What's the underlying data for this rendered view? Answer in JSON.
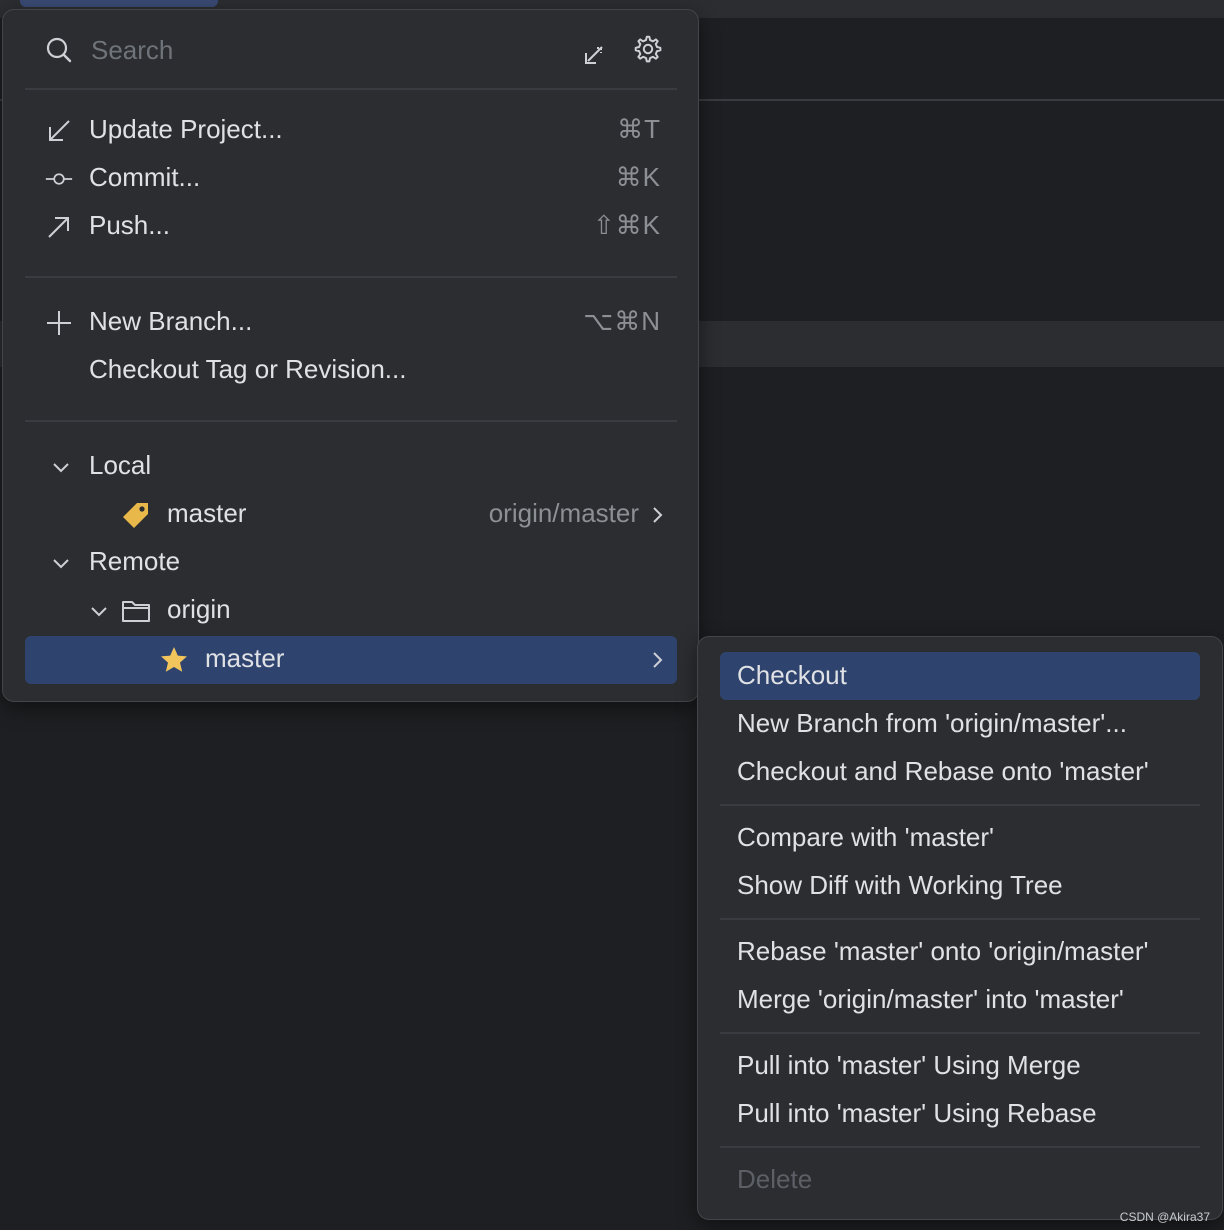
{
  "search": {
    "placeholder": "Search"
  },
  "actions": [
    {
      "label": "Update Project...",
      "shortcut": "⌘T",
      "icon": "update-arrow-icon"
    },
    {
      "label": "Commit...",
      "shortcut": "⌘K",
      "icon": "commit-icon"
    },
    {
      "label": "Push...",
      "shortcut": "⇧⌘K",
      "icon": "push-arrow-icon"
    }
  ],
  "branch_actions": [
    {
      "label": "New Branch...",
      "shortcut": "⌥⌘N",
      "icon": "plus-icon"
    },
    {
      "label": "Checkout Tag or Revision..."
    }
  ],
  "tree": {
    "local": {
      "label": "Local",
      "branches": [
        {
          "name": "master",
          "tracking": "origin/master",
          "icon": "tag-icon"
        }
      ]
    },
    "remote": {
      "label": "Remote",
      "remotes": [
        {
          "name": "origin",
          "icon": "folder-icon",
          "branches": [
            {
              "name": "master",
              "icon": "star-icon",
              "selected": true
            }
          ]
        }
      ]
    }
  },
  "submenu": {
    "groups": [
      [
        "Checkout",
        "New Branch from 'origin/master'...",
        "Checkout and Rebase onto 'master'"
      ],
      [
        "Compare with 'master'",
        "Show Diff with Working Tree"
      ],
      [
        "Rebase 'master' onto 'origin/master'",
        "Merge 'origin/master' into 'master'"
      ],
      [
        "Pull into 'master' Using Merge",
        "Pull into 'master' Using Rebase"
      ],
      [
        "Delete"
      ]
    ],
    "selected": "Checkout",
    "disabled": "Delete"
  },
  "colors": {
    "popup_bg": "#2b2d30",
    "selection": "#2e436e",
    "text": "#dfe1e5",
    "muted": "#8c8f94",
    "tag_yellow": "#e8b84a",
    "star_yellow": "#f2c55c"
  },
  "watermark": "CSDN @Akira37"
}
